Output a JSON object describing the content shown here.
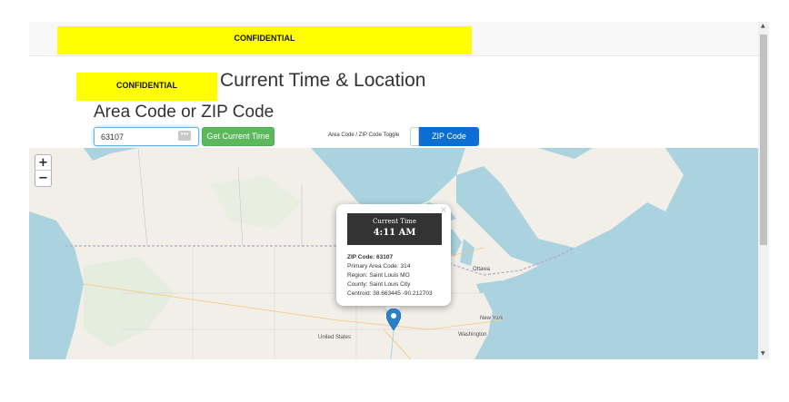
{
  "banner": {
    "text": "CONFIDENTIAL"
  },
  "side_banner": {
    "text": "CONFIDENTIAL"
  },
  "page": {
    "title": "Current Time & Location",
    "subtitle": "Area Code or ZIP Code"
  },
  "search": {
    "value": "63107",
    "dots": "•••",
    "button_label": "Get Current Time"
  },
  "toggle": {
    "label": "Area Code / ZIP Code Toggle",
    "state": "ZIP Code",
    "accent_color": "#0b6ed4"
  },
  "map": {
    "zoom_in": "+",
    "zoom_out": "−",
    "labels": {
      "ottawa": "Ottawa",
      "newyork": "New York",
      "washington": "Washington",
      "us": "United States"
    }
  },
  "popup": {
    "close": "×",
    "time_title": "Current Time",
    "time_value": "4:11 AM",
    "zip_label": "ZIP Code: 63107",
    "area_code": "Primary Area Code: 314",
    "region": "Region: Saint Louis MO",
    "county": "County: Saint Louis City",
    "centroid": "Centroid: 38.663445 -90.212703"
  },
  "marker": {
    "icon": "map-pin-icon",
    "color": "#2a81cb"
  },
  "scrollbar": {
    "up": "▲",
    "down": "▼"
  }
}
